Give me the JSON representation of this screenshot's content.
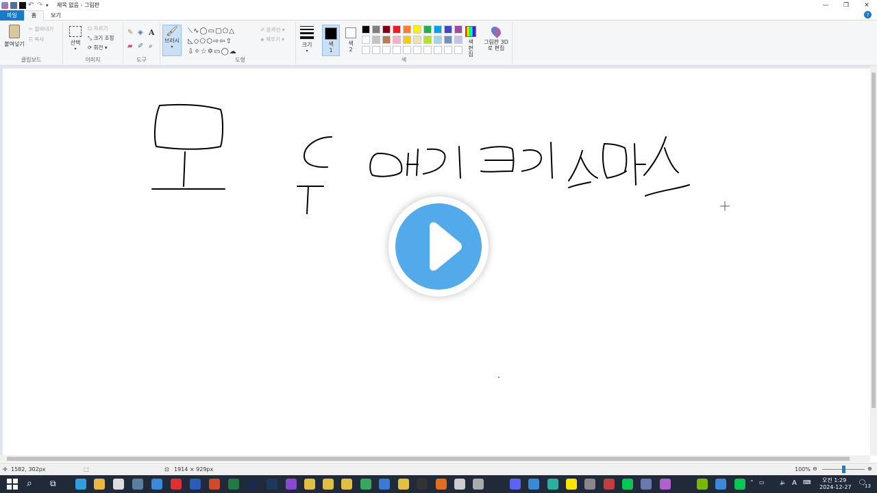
{
  "window": {
    "title": "제목 없음 - 그림판",
    "controls": {
      "minimize": "—",
      "maximize": "❐",
      "close": "✕"
    }
  },
  "tabs": [
    {
      "label": "파일"
    },
    {
      "label": "홈"
    },
    {
      "label": "보기"
    }
  ],
  "help": "?",
  "ribbon": {
    "clipboard": {
      "label": "클립보드",
      "paste": "붙여넣기",
      "cut": "잘라내기",
      "copy": "복사"
    },
    "image": {
      "label": "이미지",
      "select": "선택",
      "crop": "자르기",
      "resize": "크기 조정",
      "rotate": "회전"
    },
    "tools": {
      "label": "도구"
    },
    "brushes": {
      "label": "브러시"
    },
    "shapes": {
      "label": "도형",
      "outline": "윤곽선",
      "fill": "채우기"
    },
    "size": {
      "label": "크기"
    },
    "color1": {
      "label": "색 1"
    },
    "color2": {
      "label": "색 2"
    },
    "colors": {
      "label": "색",
      "edit": "색 편집",
      "paint3d": "그림판 3D로 편집"
    }
  },
  "palette": [
    "#000000",
    "#7f7f7f",
    "#880015",
    "#ed1c24",
    "#ff7f27",
    "#fff200",
    "#22b14c",
    "#00a2e8",
    "#3f48cc",
    "#a349a4",
    "#ffffff",
    "#c3c3c3",
    "#b97a57",
    "#ffaec9",
    "#ffc90e",
    "#efe4b0",
    "#b5e61d",
    "#99d9ea",
    "#7092be",
    "#c8bfe7",
    "#ffffff",
    "#ffffff",
    "#ffffff",
    "#ffffff",
    "#ffffff",
    "#ffffff",
    "#ffffff",
    "#ffffff",
    "#ffffff",
    "#ffffff"
  ],
  "status": {
    "cursor": "1582, 302px",
    "size": "1914 × 929px",
    "zoom": "100%"
  },
  "taskbar": {
    "time": "오전 1:29",
    "date": "2024-12-27",
    "lang": "A",
    "notif": "13"
  }
}
